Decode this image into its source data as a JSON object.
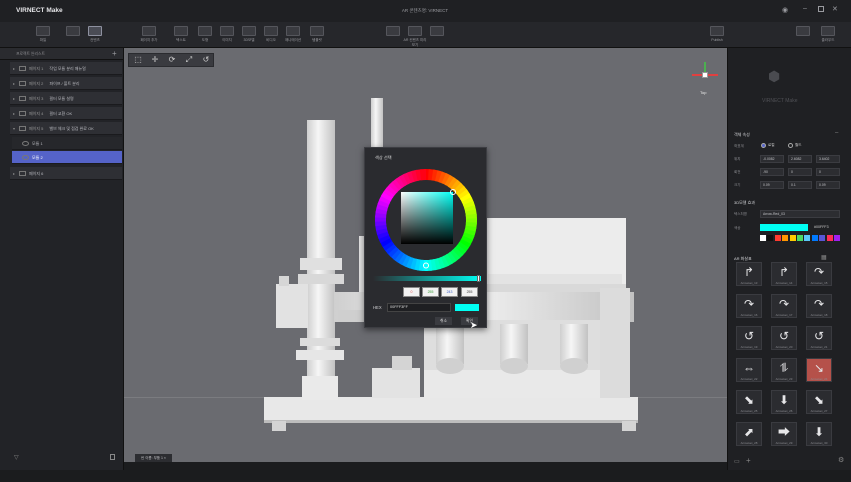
{
  "app": {
    "logo": "VIRNECT Make",
    "window_title": "AR 콘텐츠명: VIRNECT",
    "controls": [
      "pin-icon",
      "minimize-icon",
      "maximize-icon",
      "close-icon"
    ]
  },
  "toolbar": {
    "left": [
      {
        "label": "파일",
        "icon": "undo-icon"
      },
      {
        "label": "",
        "icon": "redo-icon"
      },
      {
        "label": "컨텐츠",
        "icon": "content-icon"
      }
    ],
    "items": [
      {
        "label": "페이지 추가",
        "icon": "page-add-icon"
      },
      {
        "label": "텍스트",
        "icon": "text-icon"
      },
      {
        "label": "도형",
        "icon": "shape-icon"
      },
      {
        "label": "이미지",
        "icon": "image-icon"
      },
      {
        "label": "3D모델",
        "icon": "model-icon"
      },
      {
        "label": "비디오",
        "icon": "video-icon"
      },
      {
        "label": "애니메이션",
        "icon": "animation-icon"
      },
      {
        "label": "템플릿",
        "icon": "more-icon"
      }
    ],
    "center": [
      {
        "label": "",
        "icon": "play-icon"
      },
      {
        "label": "AR 컨텐츠 미리보기",
        "icon": "preview-icon"
      },
      {
        "label": "",
        "icon": "device-icon"
      }
    ],
    "right": [
      {
        "label": "Publish",
        "icon": "publish-icon"
      },
      {
        "label": "",
        "icon": "export-icon"
      },
      {
        "label": "클라우드",
        "icon": "cloud-icon"
      }
    ]
  },
  "left_panel": {
    "header": "프로젝트 씬리스트",
    "scenes": [
      {
        "num": "페이지 1",
        "title": "작업 모듈 분리 매뉴얼"
      },
      {
        "num": "페이지 2",
        "title": "파이프 / 볼트 분리"
      },
      {
        "num": "페이지 3",
        "title": "필터 모듈 설명"
      },
      {
        "num": "페이지 4",
        "title": "필터 교환 OK"
      },
      {
        "num": "페이지 5",
        "title": "밸브 체크 및 점검 완료 OK"
      }
    ],
    "sub_items": [
      "모듈 1",
      "모듈 2"
    ],
    "last_scene": "페이지 6",
    "footer_icons": [
      "filter-icon",
      "trash-icon"
    ]
  },
  "viewport": {
    "tool_icons": [
      "select-icon",
      "move-icon",
      "rotate-icon",
      "scale-icon",
      "reset-icon"
    ],
    "gizmo_label": "Top",
    "scene_tab": "씬 이름: 부품 1"
  },
  "color_dialog": {
    "title": "색상 선택",
    "hue_deg": 180,
    "rgb": [
      "0",
      "255",
      "243",
      "255"
    ],
    "hex_label": "HEX",
    "hex_value": "00FFF3FF",
    "swatch": "#00fff3",
    "cancel": "취소",
    "ok": "확인"
  },
  "right_panel": {
    "logo": "VIRNECT Make",
    "transform": {
      "title": "객체 속성",
      "coord_label": "좌표계",
      "coord_opts": [
        "로컬",
        "월드"
      ],
      "rows": [
        {
          "label": "위치",
          "vals": [
            "-0.0082",
            "2.6082",
            "3.6402"
          ]
        },
        {
          "label": "회전",
          "vals": [
            "-90",
            "0",
            "0"
          ]
        },
        {
          "label": "크기",
          "vals": [
            "0.09",
            "0.1",
            "0.09"
          ]
        }
      ]
    },
    "visual": {
      "title": "3D모델 효과",
      "name_label": "텍스처명",
      "name_value": "Arrow-Red_03",
      "color_label": "색상",
      "color_hex": "#00FFF3",
      "palette": [
        "#ffffff",
        "#111111",
        "#ff3b30",
        "#ff9500",
        "#ffcc00",
        "#4cd964",
        "#5ac8fa",
        "#007aff",
        "#5856d6",
        "#ff2d55",
        "#a020f0"
      ]
    },
    "arrows": {
      "title": "AR 화살표",
      "items": [
        {
          "g": "↱",
          "label": "Arrowset_13"
        },
        {
          "g": "↱",
          "label": "Arrowset_14"
        },
        {
          "g": "↷",
          "label": "Arrowset_15"
        },
        {
          "g": "↷",
          "label": "Arrowset_16"
        },
        {
          "g": "↷",
          "label": "Arrowset_17"
        },
        {
          "g": "↷",
          "label": "Arrowset_18"
        },
        {
          "g": "↺",
          "label": "Arrowset_19"
        },
        {
          "g": "↺",
          "label": "Arrowset_20"
        },
        {
          "g": "↺",
          "label": "Arrowset_21"
        },
        {
          "g": "⇔",
          "label": "Arrowset_22"
        },
        {
          "g": "⥮",
          "label": "Arrowset_23"
        },
        {
          "g": "↘",
          "label": "Arrowset_24"
        },
        {
          "g": "⬊",
          "label": "Arrowset_25"
        },
        {
          "g": "⬇",
          "label": "Arrowset_26"
        },
        {
          "g": "⬊",
          "label": "Arrowset_27"
        },
        {
          "g": "⬈",
          "label": "Arrowset_28"
        },
        {
          "g": "⮕",
          "label": "Arrowset_29"
        },
        {
          "g": "⬇",
          "label": "Arrowset_30"
        }
      ]
    },
    "footer_icons": [
      "folder-icon",
      "add-icon",
      "gear-icon"
    ]
  }
}
